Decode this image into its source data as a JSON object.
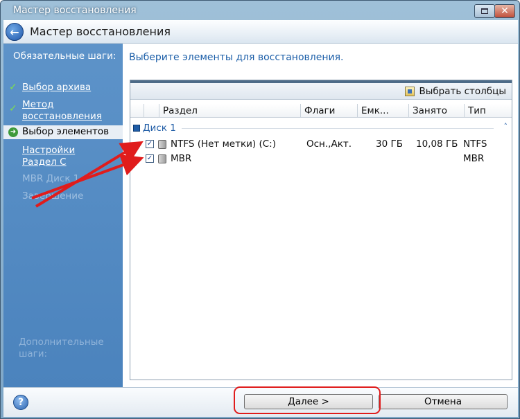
{
  "window": {
    "title": "Мастер восстановления",
    "header_title": "Мастер восстановления"
  },
  "sidebar": {
    "heading": "Обязательные шаги:",
    "items": [
      {
        "label": "Выбор архива",
        "state": "done"
      },
      {
        "label": "Метод восстановления",
        "state": "done"
      },
      {
        "label": "Выбор элементов",
        "state": "current"
      },
      {
        "label": "Настройки Раздел С",
        "state": "link"
      },
      {
        "label": "MBR Диск 1",
        "state": "disabled"
      },
      {
        "label": "Завершение",
        "state": "disabled"
      }
    ],
    "optional_heading": "Дополнительные шаги:"
  },
  "content": {
    "title": "Выберите элементы для восстановления.",
    "toolbar": {
      "choose_columns_label": "Выбрать столбцы"
    },
    "columns": [
      "Раздел",
      "Флаги",
      "Емк...",
      "Занято",
      "Тип"
    ],
    "group": {
      "label": "Диск 1",
      "toggle": "˄"
    },
    "rows": [
      {
        "checked": true,
        "name": "NTFS (Нет метки) (C:)",
        "flags": "Осн.,Акт.",
        "capacity": "30 ГБ",
        "used": "10,08 ГБ",
        "type": "NTFS"
      },
      {
        "checked": true,
        "name": "MBR",
        "flags": "",
        "capacity": "",
        "used": "",
        "type": "MBR"
      }
    ]
  },
  "footer": {
    "help_label": "?",
    "next_label": "Далее >",
    "cancel_label": "Отмена"
  },
  "colors": {
    "accent": "#1b5ea8",
    "sidebar": "#5d93c9",
    "annotation": "#e01c1c",
    "check": "#7ee04c"
  }
}
